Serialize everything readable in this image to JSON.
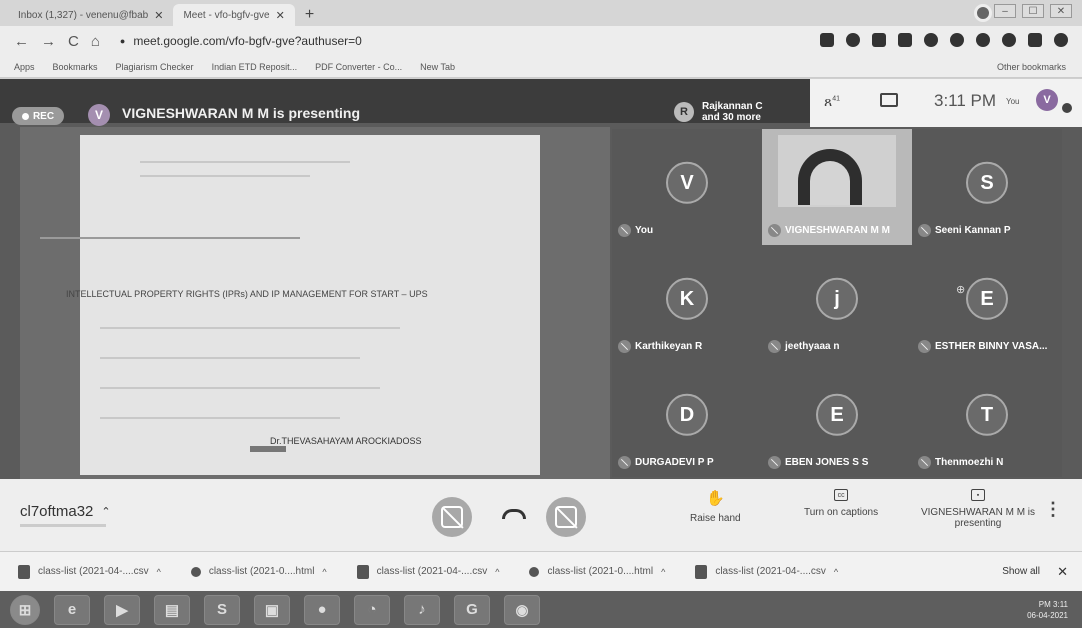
{
  "browser": {
    "tabs": [
      {
        "label": "Inbox (1,327) - venenu@fbab",
        "close": "✕"
      },
      {
        "label": "Meet - vfo-bgfv-gve",
        "close": "✕"
      }
    ],
    "new_tab": "+",
    "url": "meet.google.com/vfo-bgfv-gve?authuser=0",
    "nav": {
      "back": "←",
      "forward": "→",
      "reload": "C",
      "home": "⌂"
    },
    "bookmarks": [
      "Apps",
      "Bookmarks",
      "Plagiarism Checker",
      "Indian ETD Reposit...",
      "PDF Converter - Co...",
      "New Tab"
    ],
    "other_bookmarks": "Other bookmarks",
    "window_controls": [
      "–",
      "☐",
      "✕"
    ]
  },
  "meet": {
    "rec_label": "REC",
    "presenter_initial": "V",
    "presenting_title": "VIGNESHWARAN M M is presenting",
    "people_chip": {
      "initial": "R",
      "line1": "Rajkannan C",
      "line2": "and 30 more"
    },
    "people_icon": "ጸ",
    "people_count": "41",
    "time": "3:11 PM",
    "you_label": "You",
    "you_initial": "V",
    "slide": {
      "title": "INTELLECTUAL PROPERTY RIGHTS (IPRs) AND IP MANAGEMENT FOR START – UPS",
      "author": "Dr.THEVASAHAYAM AROCKIADOSS"
    },
    "participants": [
      {
        "initial": "V",
        "name": "You"
      },
      {
        "initial": "",
        "name": "VIGNESHWARAN M M",
        "video": true
      },
      {
        "initial": "S",
        "name": "Seeni Kannan P"
      },
      {
        "initial": "K",
        "name": "Karthikeyan R"
      },
      {
        "initial": "j",
        "name": "jeethyaaa n"
      },
      {
        "initial": "E",
        "name": "ESTHER BINNY VASA..."
      },
      {
        "initial": "D",
        "name": "DURGADEVI P P"
      },
      {
        "initial": "E",
        "name": "EBEN JONES S S"
      },
      {
        "initial": "T",
        "name": "Thenmoezhi N"
      }
    ],
    "controls": {
      "meeting_code": "cl7oftma32",
      "raise_hand": "Raise hand",
      "captions": "Turn on captions",
      "presenting": "VIGNESHWARAN M M is presenting",
      "more": "⋮"
    }
  },
  "downloads": {
    "items": [
      "class-list (2021-04-....csv",
      "class-list (2021-0....html",
      "class-list (2021-04-....csv",
      "class-list (2021-0....html",
      "class-list (2021-04-....csv"
    ],
    "show_all": "Show all",
    "close": "✕"
  },
  "taskbar": {
    "time": "PM 3:11",
    "date": "06-04-2021"
  }
}
